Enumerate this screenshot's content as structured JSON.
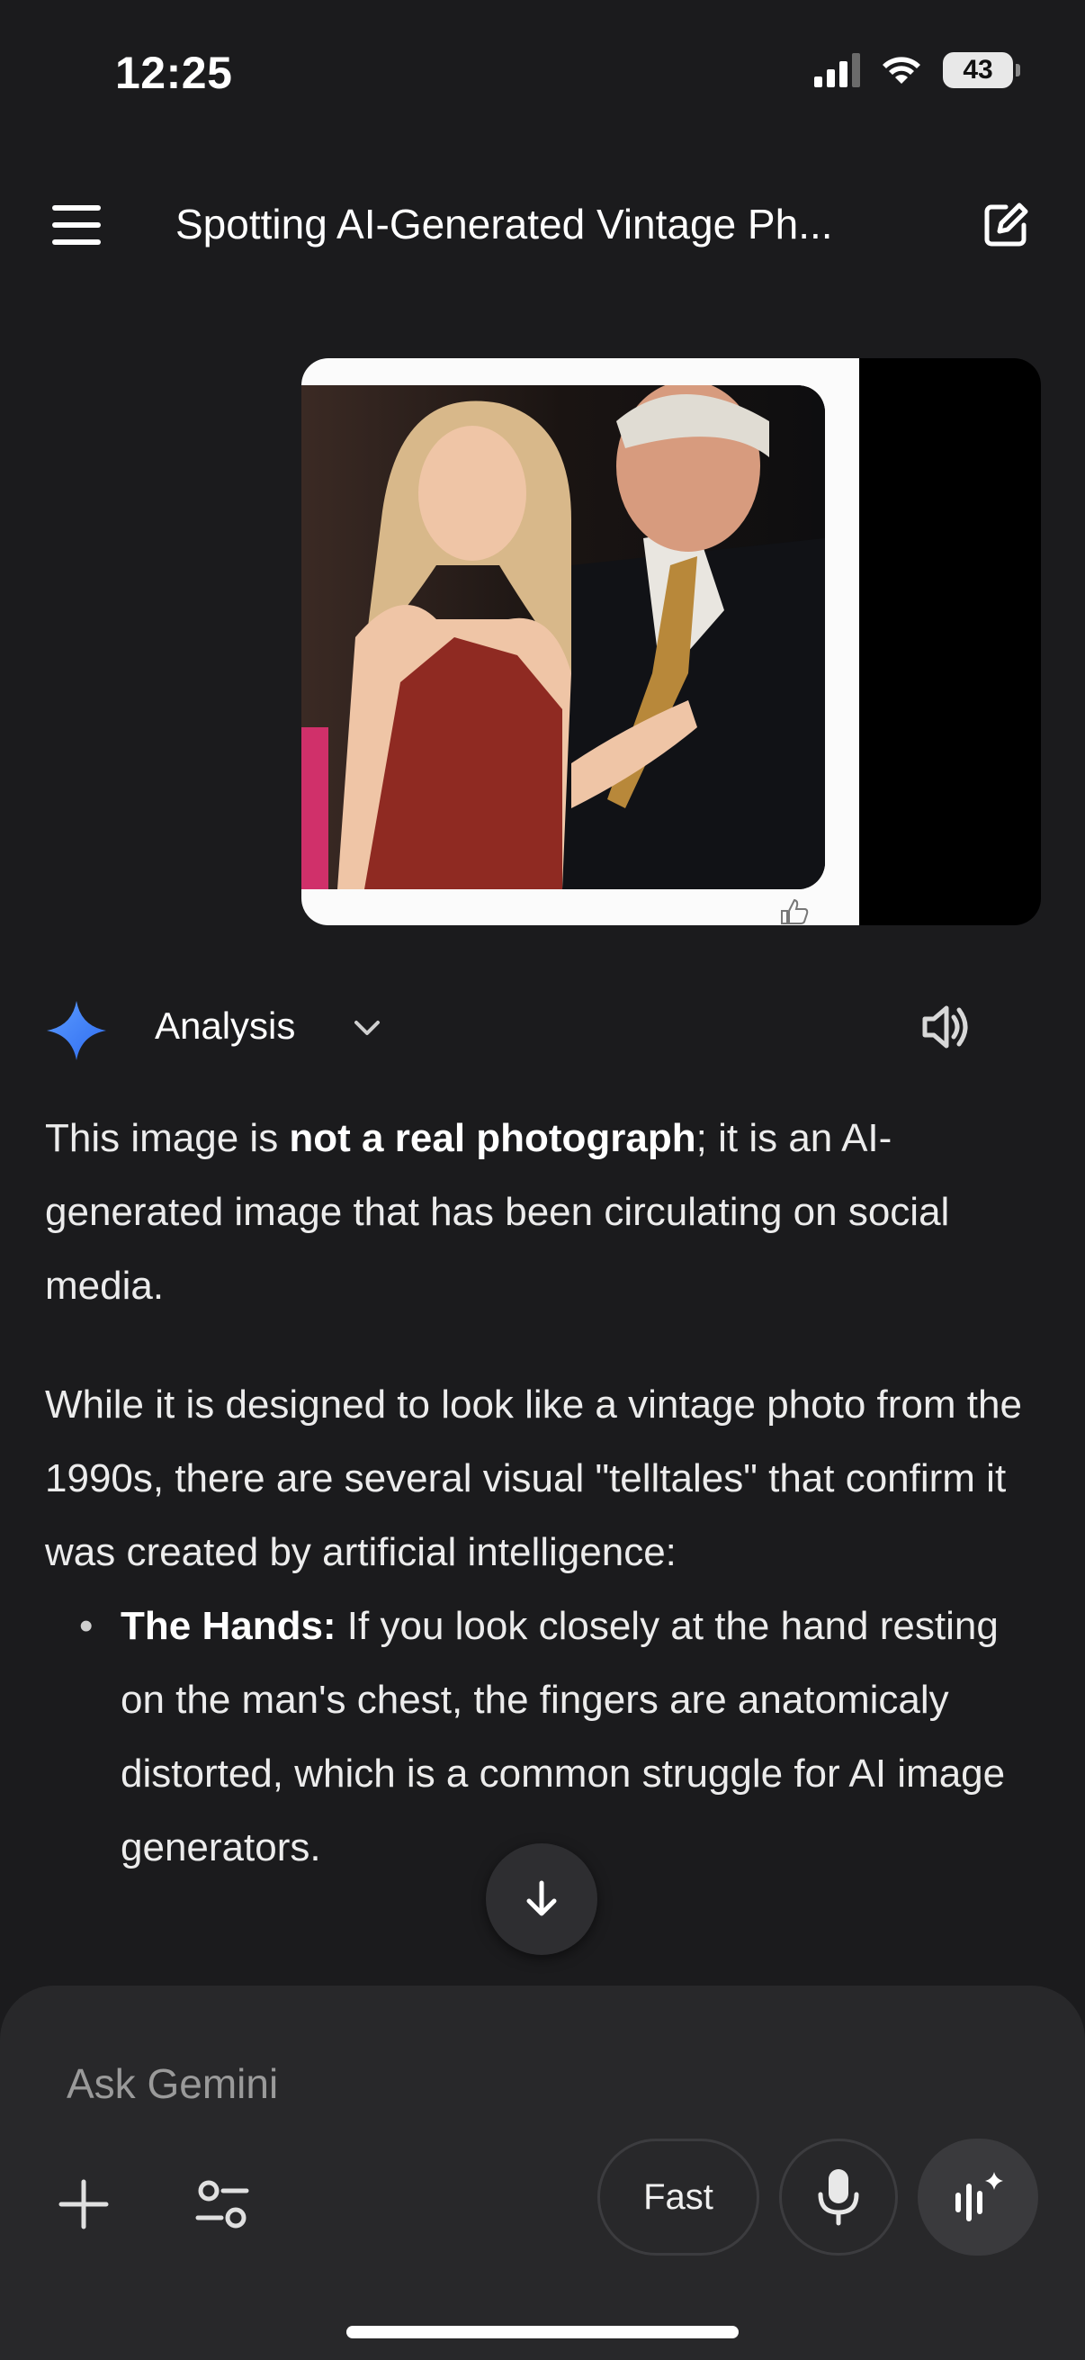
{
  "status_bar": {
    "time": "12:25",
    "battery": "43"
  },
  "header": {
    "title": "Spotting AI-Generated Vintage Ph..."
  },
  "attachment": {
    "description_icon": "thumbs-up-icon"
  },
  "response": {
    "mode_label": "Analysis",
    "paragraph1": {
      "pre": "This image is ",
      "bold": "not a real photograph",
      "post": "; it is an AI-generated image that has been circulating on social media."
    },
    "paragraph2": "While it is designed to look like a vintage photo from the 1990s, there are several visual \"telltales\" that confirm it was created by artificial intelligence:",
    "bullets": [
      {
        "bold": "The Hands:",
        "text": " If you look closely at the hand resting on the man's chest, the fingers are anatomicaly distorted, which is a common struggle for AI image generators."
      }
    ]
  },
  "input": {
    "placeholder": "Ask Gemini",
    "fast_label": "Fast"
  },
  "colors": {
    "background": "#1b1b1d",
    "panel": "#28282a",
    "gemini_blue": "#4a8cff"
  }
}
